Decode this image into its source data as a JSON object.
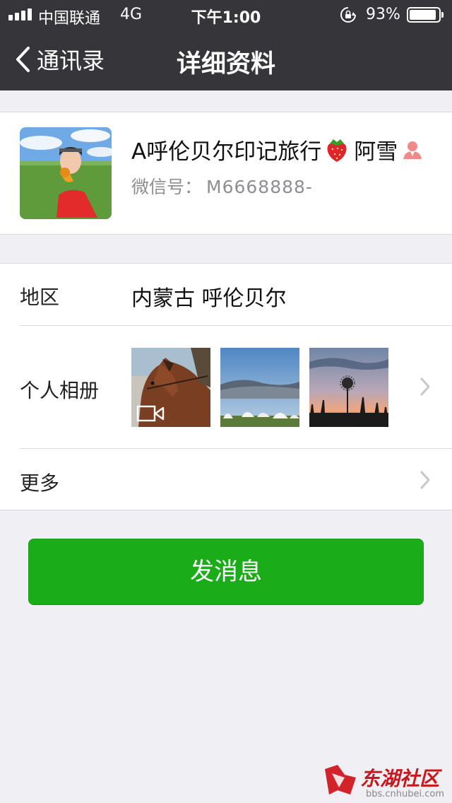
{
  "status_bar": {
    "carrier": "中国联通",
    "network": "4G",
    "time": "下午1:00",
    "battery_percent": "93%",
    "battery_level": 0.93,
    "signal_bars": 4
  },
  "nav": {
    "back_label": "通讯录",
    "title": "详细资料"
  },
  "profile": {
    "name": "A呼伦贝尔印记旅行",
    "nickname": "阿雪",
    "wechat_id_label": "微信号：",
    "wechat_id": "M6668888-"
  },
  "region": {
    "label": "地区",
    "value": "内蒙古 呼伦贝尔"
  },
  "album": {
    "label": "个人相册",
    "photos": [
      {
        "subject": "horse",
        "is_video": true
      },
      {
        "subject": "yurts",
        "is_video": false
      },
      {
        "subject": "dandelion sunset",
        "is_video": false
      }
    ]
  },
  "more": {
    "label": "更多"
  },
  "send_button": {
    "label": "发消息",
    "color": "#1aad19"
  },
  "watermark": {
    "name": "东湖社区",
    "url": "bbs.cnhubei.com"
  },
  "colors": {
    "nav_background": "#36363a",
    "page_background": "#efeff4",
    "secondary_text": "#8e8e93"
  },
  "icons": [
    "chevron-left-icon",
    "strawberry-icon",
    "person-icon",
    "video-icon",
    "chevron-right-icon",
    "rotation-lock-icon"
  ]
}
